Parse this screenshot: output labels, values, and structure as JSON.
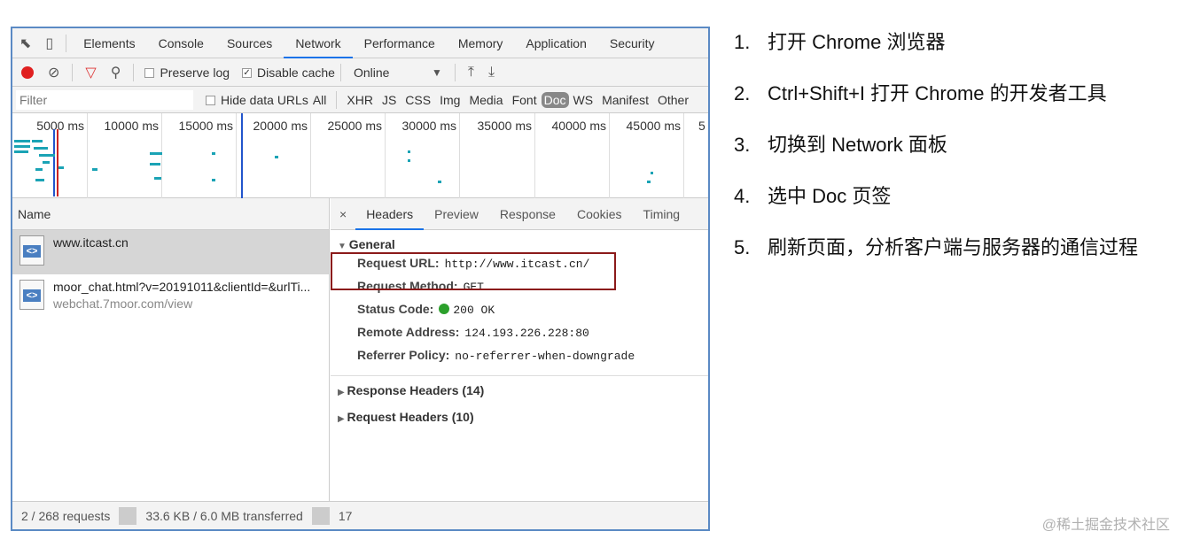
{
  "devtools": {
    "tabs": [
      "Elements",
      "Console",
      "Sources",
      "Network",
      "Performance",
      "Memory",
      "Application",
      "Security"
    ],
    "active_tab": "Network",
    "toolbar": {
      "preserve_log": "Preserve log",
      "disable_cache": "Disable cache",
      "throttle": "Online"
    },
    "filter": {
      "placeholder": "Filter",
      "hide_data_urls": "Hide data URLs",
      "types": [
        "All",
        "XHR",
        "JS",
        "CSS",
        "Img",
        "Media",
        "Font",
        "Doc",
        "WS",
        "Manifest",
        "Other"
      ],
      "selected_type": "Doc"
    },
    "timeline_ticks": [
      "5000 ms",
      "10000 ms",
      "15000 ms",
      "20000 ms",
      "25000 ms",
      "30000 ms",
      "35000 ms",
      "40000 ms",
      "45000 ms",
      "5"
    ],
    "name_header": "Name",
    "requests": [
      {
        "name": "www.itcast.cn",
        "sub": ""
      },
      {
        "name": "moor_chat.html?v=20191011&clientId=&urlTi...",
        "sub": "webchat.7moor.com/view"
      }
    ],
    "detail_tabs": [
      "×",
      "Headers",
      "Preview",
      "Response",
      "Cookies",
      "Timing"
    ],
    "detail_active": "Headers",
    "general": {
      "title": "General",
      "url_key": "Request URL:",
      "url_val": "http://www.itcast.cn/",
      "method_key": "Request Method:",
      "method_val": "GET",
      "status_key": "Status Code:",
      "status_val": "200 OK",
      "remote_key": "Remote Address:",
      "remote_val": "124.193.226.228:80",
      "referrer_key": "Referrer Policy:",
      "referrer_val": "no-referrer-when-downgrade"
    },
    "response_headers": "Response Headers (14)",
    "request_headers": "Request Headers (10)",
    "status": {
      "requests": "2 / 268 requests",
      "transferred": "33.6 KB / 6.0 MB transferred",
      "extra": "17"
    }
  },
  "steps": [
    {
      "num": "1.",
      "text": "打开 Chrome 浏览器"
    },
    {
      "num": "2.",
      "text": "Ctrl+Shift+I 打开 Chrome 的开发者工具"
    },
    {
      "num": "3.",
      "text": "切换到 Network 面板"
    },
    {
      "num": "4.",
      "text": "选中 Doc 页签"
    },
    {
      "num": "5.",
      "text": "刷新页面，分析客户端与服务器的通信过程"
    }
  ],
  "watermark": "@稀土掘金技术社区",
  "colors": {
    "accent": "#1a73e8",
    "highlight": "#8b1a1a",
    "record": "#e02020"
  }
}
